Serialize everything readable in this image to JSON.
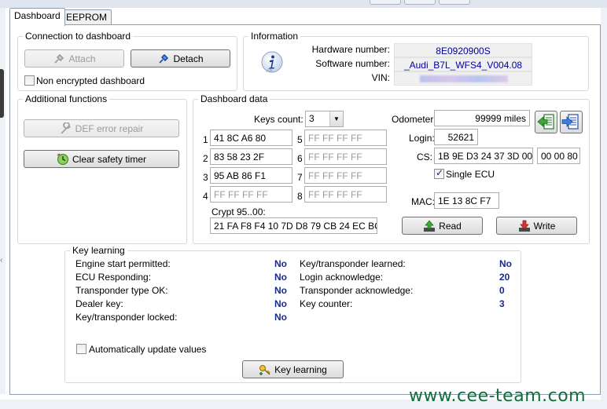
{
  "tabs": [
    {
      "label": "Dashboard",
      "active": true
    },
    {
      "label": "EEPROM",
      "active": false
    }
  ],
  "connection": {
    "title": "Connection to dashboard",
    "attach_label": "Attach",
    "detach_label": "Detach",
    "non_encrypted_label": "Non encrypted dashboard",
    "non_encrypted_checked": false
  },
  "information": {
    "title": "Information",
    "icon": "info-icon",
    "hardware_label": "Hardware number:",
    "hardware_value": "8E0920900S",
    "software_label": "Software number:",
    "software_value": "_Audi_B7L_WFS4_V004.08",
    "vin_label": "VIN:"
  },
  "additional": {
    "title": "Additional functions",
    "def_label": "DEF error repair",
    "clear_label": "Clear safety timer"
  },
  "dashboard_data": {
    "title": "Dashboard data",
    "keys_count_label": "Keys count:",
    "keys_count_value": "3",
    "keys": [
      {
        "n": "1",
        "value": "41 8C A6 80",
        "active": true
      },
      {
        "n": "2",
        "value": "83 58 23 2F",
        "active": true
      },
      {
        "n": "3",
        "value": "95 AB 86 F1",
        "active": true
      },
      {
        "n": "4",
        "value": "FF FF FF FF",
        "active": false
      },
      {
        "n": "5",
        "value": "FF FF FF FF",
        "active": false
      },
      {
        "n": "6",
        "value": "FF FF FF FF",
        "active": false
      },
      {
        "n": "7",
        "value": "FF FF FF FF",
        "active": false
      },
      {
        "n": "8",
        "value": "FF FF FF FF",
        "active": false
      }
    ],
    "crypt_label": "Crypt 95..00:",
    "crypt_value": "21 FA F8 F4 10 7D D8 79 CB 24 EC BC",
    "odometer_label": "Odometer:",
    "odometer_value": "99999 miles",
    "login_label": "Login:",
    "login_value": "52621",
    "cs_label": "CS:",
    "cs_value": "1B 9E D3 24 37 3D 00",
    "cs_value2": "00 00 80",
    "single_ecu_label": "Single ECU",
    "single_ecu_checked": true,
    "mac_label": "MAC:",
    "mac_value": "1E 13 8C F7",
    "read_label": "Read",
    "write_label": "Write"
  },
  "key_learning": {
    "title": "Key learning",
    "rows_left": [
      {
        "label": "Engine start permitted:",
        "value": "No"
      },
      {
        "label": "ECU Responding:",
        "value": "No"
      },
      {
        "label": "Transponder type OK:",
        "value": "No"
      },
      {
        "label": "Dealer key:",
        "value": "No"
      },
      {
        "label": "Key/transponder locked:",
        "value": "No"
      }
    ],
    "rows_right": [
      {
        "label": "Key/transponder learned:",
        "value": "No"
      },
      {
        "label": "Login acknowledge:",
        "value": "20"
      },
      {
        "label": "Transponder acknowledge:",
        "value": "0"
      },
      {
        "label": "Key counter:",
        "value": "3"
      }
    ],
    "auto_update_label": "Automatically update values",
    "auto_update_checked": false,
    "button_label": "Key learning"
  },
  "watermark": "www.cee-team.com",
  "colors": {
    "value_blue": "#1a2a8c",
    "ro_text": "#0000a0",
    "watermark": "#0f6e3a"
  }
}
